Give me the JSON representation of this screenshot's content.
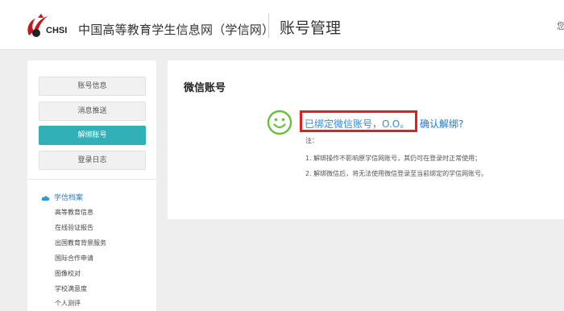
{
  "header": {
    "logo_text": "CHSI",
    "site_title": "中国高等教育学生信息网（学信网）",
    "page_title": "账号管理",
    "user_greeting": "您"
  },
  "sidebar": {
    "nav_buttons": [
      {
        "label": "账号信息",
        "active": false
      },
      {
        "label": "消息推送",
        "active": false
      },
      {
        "label": "解绑账号",
        "active": true
      },
      {
        "label": "登录日志",
        "active": false
      }
    ],
    "section_title": "学信档案",
    "section_icon": "cloud-icon",
    "section_items": [
      "高等教育信息",
      "在线验证报告",
      "出国教育背景服务",
      "国际合作申请",
      "图像校对",
      "学校满意度",
      "个人测评"
    ]
  },
  "main": {
    "title": "微信账号",
    "status_icon": "smiley-icon",
    "bound_text": "已绑定微信账号，O.O。",
    "unbind_link": "确认解绑?",
    "note_label": "注：",
    "notes": [
      "1. 解绑操作不影响原学信网账号，其仍可在登录时正常使用；",
      "2. 解绑微信后，将无法使用微信登录至当前绑定的学信网账号。"
    ]
  },
  "colors": {
    "accent": "#31b0b7",
    "link": "#2176c7",
    "highlight_box": "#e02020",
    "smiley": "#6abf3e",
    "logo_red": "#c8161d"
  }
}
